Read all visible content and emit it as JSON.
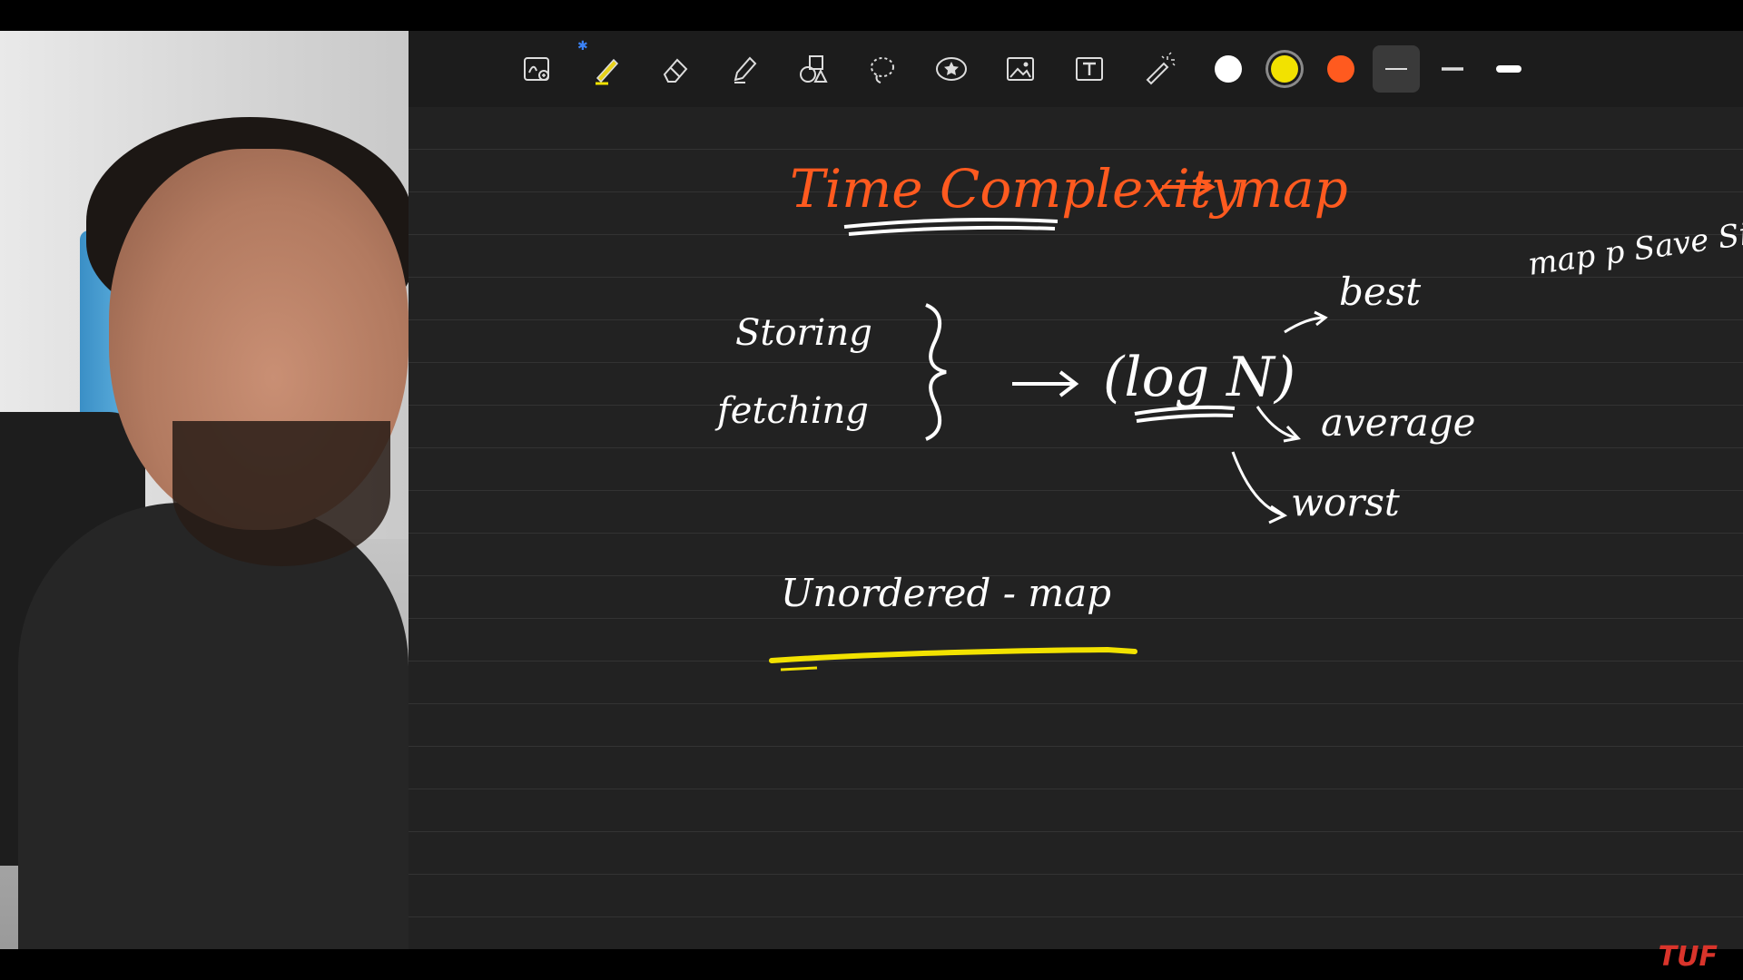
{
  "colors": {
    "pen_white": "#ffffff",
    "pen_yellow": "#f2e200",
    "pen_orange": "#ff5a1f",
    "logo_red": "#d9342b"
  },
  "toolbar": {
    "tools": [
      {
        "icon": "zoom-box-icon"
      },
      {
        "icon": "pen-icon",
        "selected": true
      },
      {
        "icon": "eraser-icon"
      },
      {
        "icon": "highlighter-icon"
      },
      {
        "icon": "shapes-icon"
      },
      {
        "icon": "lasso-icon"
      },
      {
        "icon": "sticker-icon"
      },
      {
        "icon": "image-icon"
      },
      {
        "icon": "textbox-icon"
      },
      {
        "icon": "laser-pointer-icon"
      }
    ],
    "colors_selected": "yellow",
    "stroke_selected": "thin"
  },
  "notes": {
    "title": "Time Complexity",
    "arrow_target": "map",
    "storing": "Storing",
    "fetching": "fetching",
    "complexity": "(log N)",
    "best": "best",
    "average": "average",
    "worst": "worst",
    "side_note": "map p Save Si",
    "heading2": "Unordered - map"
  },
  "logo": "TUF"
}
